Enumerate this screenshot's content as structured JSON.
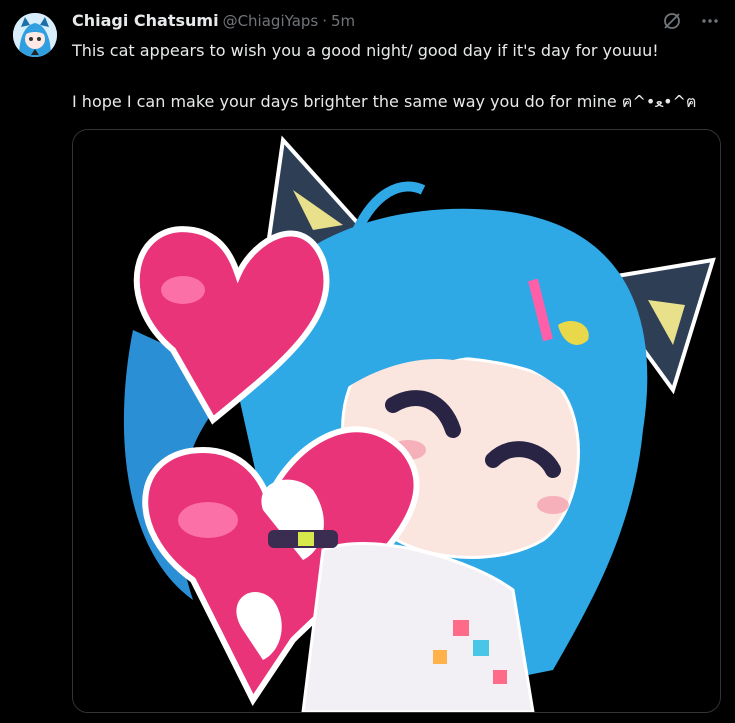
{
  "tweet": {
    "display_name": "Chiagi Chatsumi",
    "handle": "@ChiagiYaps",
    "separator": "·",
    "timestamp": "5m",
    "text_line1": "This cat appears to wish you a good night/ good day if it's day for youuu!",
    "text_line2": "I hope I can make your days brighter the same way you do for mine ฅ^•ﻌ•^ฅ"
  },
  "icons": {
    "avatar": "avatar",
    "grok": "grok-icon",
    "more": "more-icon"
  },
  "colors": {
    "background": "#000000",
    "text": "#e7e9ea",
    "muted": "#71767b",
    "border": "#333639",
    "hair": "#2fa8e6",
    "heart": "#e9347a"
  }
}
